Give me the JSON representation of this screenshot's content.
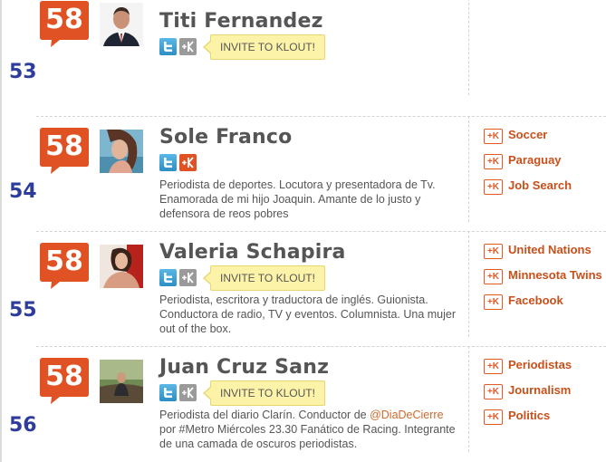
{
  "entries": [
    {
      "rank": "53",
      "score": "58",
      "name": "Titi Fernandez",
      "invite_label": "INVITE TO KLOUT!",
      "bio": "",
      "topics": []
    },
    {
      "rank": "54",
      "score": "58",
      "name": "Sole Franco",
      "bio": "Periodista de deportes. Locutora y presentadora de Tv. Enamorada de mi hijo Joaquin. Amante de lo justo y defensora de reos pobres",
      "topics": [
        "Soccer",
        "Paraguay",
        "Job Search"
      ]
    },
    {
      "rank": "55",
      "score": "58",
      "name": "Valeria Schapira",
      "invite_label": "INVITE TO KLOUT!",
      "bio": "Periodista, escritora y traductora de inglés. Guionista. Conductora de radio, TV y eventos. Columnista. Una mujer out of the box.",
      "topics": [
        "United Nations",
        "Minnesota Twins",
        "Facebook"
      ]
    },
    {
      "rank": "56",
      "score": "58",
      "name": "Juan Cruz Sanz",
      "invite_label": "INVITE TO KLOUT!",
      "bio_before": "Periodista del diario Clarín. Conductor de ",
      "bio_mention": "@DiaDeCierre",
      "bio_after": " por #Metro Miércoles 23.30 Fanático de Racing. Integrante de una camada de oscuros periodistas.",
      "topics": [
        "Periodistas",
        "Journalism",
        "Politics"
      ]
    }
  ],
  "topic_badge": "+K",
  "colors": {
    "score_bg": "#e05223",
    "rank": "#2e3d9c",
    "topic": "#c8501a",
    "invite_bg": "#fdf3a8"
  },
  "icons": {
    "twitter": "twitter-icon",
    "klout": "klout-icon",
    "plusk": "plus-k-icon"
  }
}
